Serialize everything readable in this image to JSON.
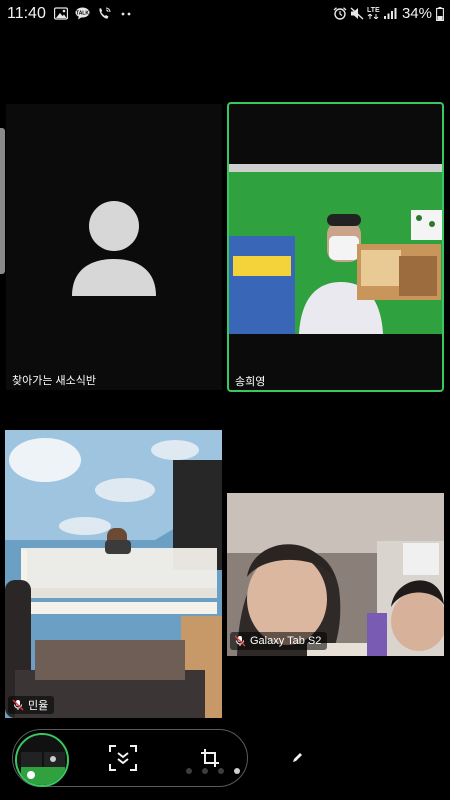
{
  "status_bar": {
    "time": "11:40",
    "battery_percent": "34%",
    "network": "LTE",
    "icons": [
      "gallery-icon",
      "talk-icon",
      "wifi-call-icon",
      "more-dots-icon",
      "alarm-icon",
      "mute-icon",
      "lte-icon",
      "signal-icon",
      "battery-icon"
    ]
  },
  "participants": [
    {
      "id": "tile-1",
      "name": "찾아가는 새소식반",
      "video": false,
      "active_speaker": false,
      "muted": false
    },
    {
      "id": "tile-2",
      "name": "송희영",
      "video": true,
      "active_speaker": true,
      "muted": false
    },
    {
      "id": "tile-3",
      "name": "민율",
      "video": true,
      "active_speaker": false,
      "muted": true
    },
    {
      "id": "tile-4",
      "name": "Galaxy Tab S2",
      "video": true,
      "active_speaker": false,
      "muted": true
    }
  ],
  "controls": {
    "icons": [
      "self-view-thumbnail",
      "collapse-icon",
      "crop-icon",
      "pen-icon"
    ]
  },
  "pager": {
    "pages": 4,
    "current": 4
  },
  "colors": {
    "active_border": "#38c760",
    "background": "#000000",
    "placeholder_bg": "#0b0b0b"
  }
}
